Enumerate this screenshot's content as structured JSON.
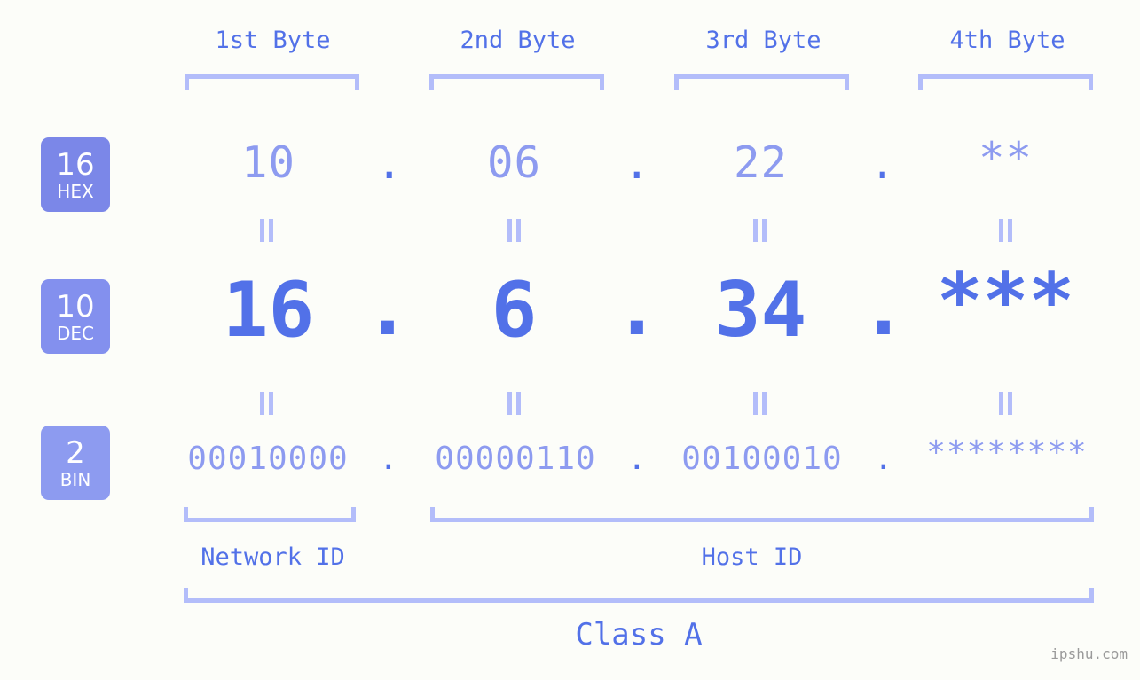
{
  "background_color": "#fcfdf9",
  "accent_color": "#5271e8",
  "light_accent_color": "#8d9bf0",
  "bracket_color": "#b3bdfa",
  "byte_headers": [
    {
      "label": "1st Byte"
    },
    {
      "label": "2nd Byte"
    },
    {
      "label": "3rd Byte"
    },
    {
      "label": "4th Byte"
    }
  ],
  "rows": [
    {
      "badge_number": "16",
      "badge_name": "HEX",
      "badge_color": "#7b87e8",
      "values": [
        "10",
        "06",
        "22",
        "**"
      ],
      "separator": "."
    },
    {
      "badge_number": "10",
      "badge_name": "DEC",
      "badge_color": "#8390ee",
      "values": [
        "16",
        "6",
        "34",
        "***"
      ],
      "separator": "."
    },
    {
      "badge_number": "2",
      "badge_name": "BIN",
      "badge_color": "#8d9bf0",
      "values": [
        "00010000",
        "00000110",
        "00100010",
        "********"
      ],
      "separator": "."
    }
  ],
  "connector_symbol": "=",
  "sections": [
    {
      "label": "Network ID"
    },
    {
      "label": "Host ID"
    }
  ],
  "class_label": "Class A",
  "watermark": "ipshu.com"
}
